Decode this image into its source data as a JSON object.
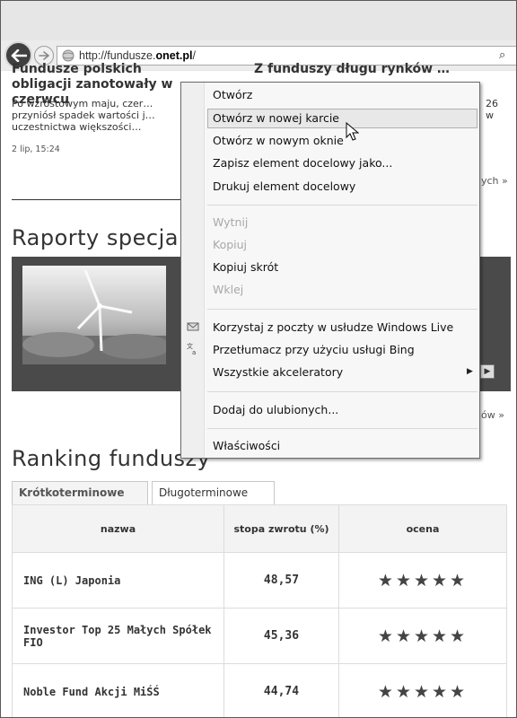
{
  "browser": {
    "url_prefix": "http://fundusze.",
    "url_domain": "onet.pl",
    "url_suffix": "/",
    "search_icon_glyph": "⌕"
  },
  "articles": {
    "left_title": "Fundusze polskich obligacji zanotowały w czerwcu",
    "left_snippet": "Po wzrostowym maju, czer… przyniósł spadek wartości j… uczestnictwa większości…",
    "left_date": "2 lip, 15:24",
    "right_title": "Z funduszy długu rynków …",
    "right_snippet_1": "26",
    "right_snippet_2": "w",
    "more_link": "ych »"
  },
  "sections": {
    "raporty_title": "Raporty specjalne",
    "more_link_2": "ów »",
    "ranking_title": "Ranking funduszy"
  },
  "ranking": {
    "tabs": [
      "Krótkoterminowe",
      "Długoterminowe"
    ],
    "columns": [
      "nazwa",
      "stopa zwrotu (%)",
      "ocena"
    ],
    "rows": [
      {
        "name": "ING (L) Japonia",
        "rate": "48,57",
        "rating": 5,
        "stars": "★★★★★"
      },
      {
        "name": "Investor Top 25 Małych Spółek FIO",
        "rate": "45,36",
        "rating": 5,
        "stars": "★★★★★"
      },
      {
        "name": "Noble Fund Akcji MiŚŚ",
        "rate": "44,74",
        "rating": 5,
        "stars": "★★★★★"
      }
    ]
  },
  "context_menu": {
    "items": [
      {
        "label": "Otwórz",
        "enabled": true
      },
      {
        "label": "Otwórz w nowej karcie",
        "enabled": true,
        "highlighted": true
      },
      {
        "label": "Otwórz w nowym oknie",
        "enabled": true
      },
      {
        "label": "Zapisz element docelowy jako...",
        "enabled": true
      },
      {
        "label": "Drukuj element docelowy",
        "enabled": true
      },
      {
        "label": "Wytnij",
        "enabled": false
      },
      {
        "label": "Kopiuj",
        "enabled": false
      },
      {
        "label": "Kopiuj skrót",
        "enabled": true
      },
      {
        "label": "Wklej",
        "enabled": false
      },
      {
        "label": "Korzystaj z poczty w usłudze Windows Live",
        "enabled": true,
        "icon": "mail-icon"
      },
      {
        "label": "Przetłumacz przy użyciu usługi Bing",
        "enabled": true,
        "icon": "translate-icon"
      },
      {
        "label": "Wszystkie akceleratory",
        "enabled": true,
        "submenu": true
      },
      {
        "label": "Dodaj do ulubionych...",
        "enabled": true
      },
      {
        "label": "Właściwości",
        "enabled": true
      }
    ]
  },
  "colors": {
    "chrome": "#e6e6e6",
    "menu_bg": "#f7f7f7",
    "highlight": "#e8e8e8"
  }
}
